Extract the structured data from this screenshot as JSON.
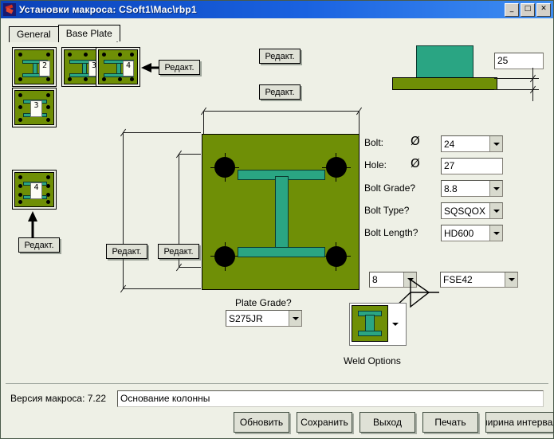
{
  "window": {
    "title": "Установки макроса: CSoft1\\Mac\\rbp1",
    "icon": "app-icon",
    "minimize": "_",
    "maximize": "□",
    "close": "✕",
    "titlebar_color": "#1050d0"
  },
  "tabs": [
    {
      "label": "General",
      "active": false
    },
    {
      "label": "Base Plate",
      "active": true
    }
  ],
  "colors": {
    "plate_olive": "#6f8f06",
    "beam_teal": "#2aa583",
    "panel_bg": "#eef0e6",
    "bolt_black": "#000000"
  },
  "sidebar": {
    "items": [
      {
        "label": "2",
        "bolts": 4,
        "orientation": "horizontal"
      },
      {
        "label": "3",
        "bolts": 4,
        "orientation": "horizontal"
      },
      {
        "label": "4",
        "bolts": 6,
        "orientation": "horizontal"
      },
      {
        "label": "3",
        "bolts": 6,
        "orientation": "vertical"
      },
      {
        "label": "4",
        "bolts": 8,
        "orientation": "vertical"
      }
    ],
    "edit_button": "Редакт."
  },
  "drawing": {
    "edit_label": "Редакт.",
    "dimension_buttons": [
      {
        "name": "plate-width-outer",
        "label": "Редакт."
      },
      {
        "name": "bolt-spacing-x",
        "label": "Редакт."
      },
      {
        "name": "plate-height-outer",
        "label": "Редакт."
      },
      {
        "name": "bolt-spacing-y",
        "label": "Редакт."
      },
      {
        "name": "profile-select",
        "label": "Редакт."
      },
      {
        "name": "sidebar-select",
        "label": "Редакт."
      }
    ]
  },
  "elevation": {
    "thickness_value": "25"
  },
  "form": {
    "rows": [
      {
        "label": "Bolt:",
        "symbol": "Ø",
        "value": "24",
        "control": "combo"
      },
      {
        "label": "Hole:",
        "symbol": "Ø",
        "value": "27",
        "control": "text"
      },
      {
        "label": "Bolt Grade?",
        "symbol": "",
        "value": "8.8",
        "control": "combo"
      },
      {
        "label": "Bolt Type?",
        "symbol": "",
        "value": "SQSQOX",
        "control": "combo"
      },
      {
        "label": "Bolt Length?",
        "symbol": "",
        "value": "HD600",
        "control": "combo"
      }
    ],
    "plate_grade_label": "Plate Grade?",
    "plate_grade_value": "S275JR",
    "weld_size_value": "8",
    "weld_electrode_value": "FSE42",
    "weld_options_label": "Weld Options"
  },
  "footer": {
    "version_label": "Версия макроса: 7.22",
    "description_value": "Основание колонны",
    "buttons": [
      {
        "label": "Обновить"
      },
      {
        "label": "Сохранить"
      },
      {
        "label": "Выход"
      },
      {
        "label": "Печать"
      },
      {
        "label": "ширина интервала"
      }
    ]
  }
}
